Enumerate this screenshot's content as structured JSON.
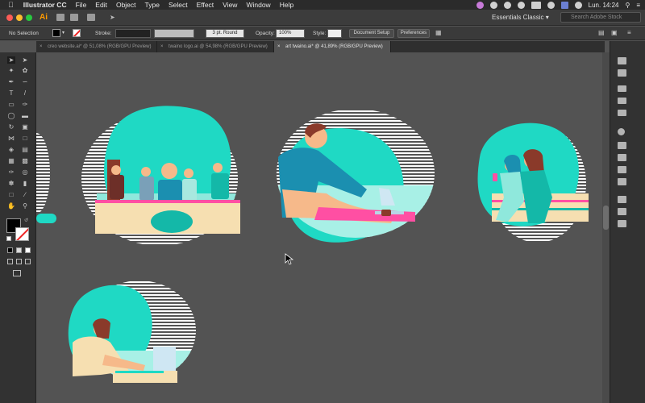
{
  "menubar": {
    "apple_icon": "apple-icon",
    "app_name": "Illustrator CC",
    "items": [
      "File",
      "Edit",
      "Object",
      "Type",
      "Select",
      "Effect",
      "View",
      "Window",
      "Help"
    ],
    "clock": "Lun. 14:24"
  },
  "appbar": {
    "logo": "Ai",
    "workspace": "Essentials Classic",
    "search_placeholder": "Search Adobe Stock"
  },
  "control": {
    "selection": "No Selection",
    "stroke_label": "Stroke:",
    "brush": "3 pt. Round",
    "opacity_label": "Opacity:",
    "opacity_value": "100%",
    "style_label": "Style:",
    "document_setup": "Document Setup",
    "preferences": "Preferences"
  },
  "tabs": [
    "creo website.ai* @ 51,08% (RGB/GPU Preview)",
    "twaino logo.ai @ 54,98% (RGB/GPU Preview)",
    "art twaino.ai* @ 41,89% (RGB/GPU Preview)"
  ],
  "colors": {
    "teal": "#1fd9c4",
    "teal_dark": "#14b8a8",
    "pink": "#ff4fa3",
    "skin": "#f6b98a",
    "sand": "#f6dfb1",
    "accent_orange": "#ff9a00"
  }
}
